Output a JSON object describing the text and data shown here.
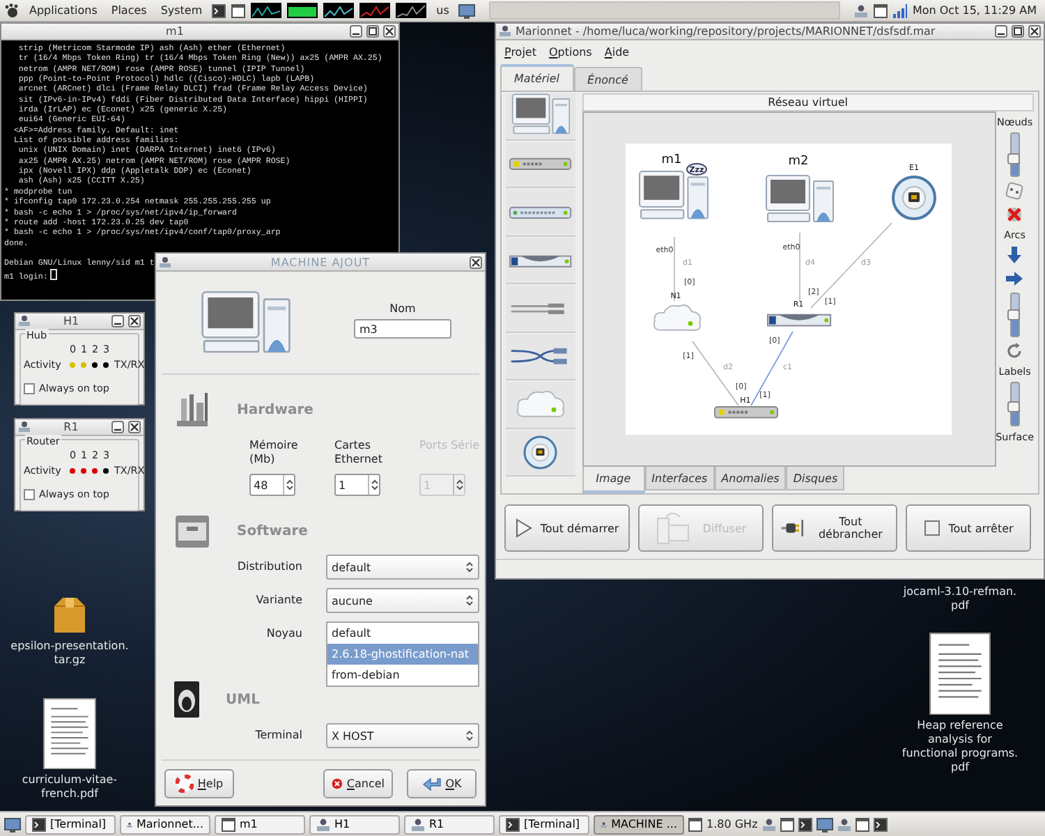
{
  "top_panel": {
    "menus": [
      "Applications",
      "Places",
      "System"
    ],
    "keyboard_layout": "us",
    "clock": "Mon Oct 15, 11:29 AM"
  },
  "terminal": {
    "title": "m1",
    "output": [
      "   strip (Metricom Starmode IP) ash (Ash) ether (Ethernet)",
      "   tr (16/4 Mbps Token Ring) tr (16/4 Mbps Token Ring (New)) ax25 (AMPR AX.25)",
      "   netrom (AMPR NET/ROM) rose (AMPR ROSE) tunnel (IPIP Tunnel)",
      "   ppp (Point-to-Point Protocol) hdlc ((Cisco)-HDLC) lapb (LAPB)",
      "   arcnet (ARCnet) dlci (Frame Relay DLCI) frad (Frame Relay Access Device)",
      "   sit (IPv6-in-IPv4) fddi (Fiber Distributed Data Interface) hippi (HIPPI)",
      "   irda (IrLAP) ec (Econet) x25 (generic X.25)",
      "   eui64 (Generic EUI-64)",
      "  <AF>=Address family. Default: inet",
      "  List of possible address families:",
      "   unix (UNIX Domain) inet (DARPA Internet) inet6 (IPv6)",
      "   ax25 (AMPR AX.25) netrom (AMPR NET/ROM) rose (AMPR ROSE)",
      "   ipx (Novell IPX) ddp (Appletalk DDP) ec (Econet)",
      "   ash (Ash) x25 (CCITT X.25)",
      "* modprobe tun",
      "* ifconfig tap0 172.23.0.254 netmask 255.255.255.255 up",
      "* bash -c echo 1 > /proc/sys/net/ipv4/ip_forward",
      "* route add -host 172.23.0.25 dev tap0",
      "* bash -c echo 1 > /proc/sys/net/ipv4/conf/tap0/proxy_arp",
      "done."
    ],
    "banner": "Debian GNU/Linux lenny/sid m1 t",
    "prompt": "m1 login:"
  },
  "monitors": [
    {
      "title": "H1",
      "group": "Hub",
      "ports": [
        "0",
        "1",
        "2",
        "3"
      ],
      "activity_label": "Activity",
      "traffic_label": "TX/RX",
      "leds": [
        {
          "color": "#d8c000"
        },
        {
          "color": "#d8c000"
        },
        {
          "color": "#000000"
        },
        {
          "color": "#000000"
        }
      ],
      "always_on_top": {
        "label": "Always on top",
        "checked": false
      }
    },
    {
      "title": "R1",
      "group": "Router",
      "ports": [
        "0",
        "1",
        "2",
        "3"
      ],
      "activity_label": "Activity",
      "traffic_label": "TX/RX",
      "leds": [
        {
          "color": "#e00000"
        },
        {
          "color": "#e00000"
        },
        {
          "color": "#e00000"
        },
        {
          "color": "#000000"
        }
      ],
      "always_on_top": {
        "label": "Always on top",
        "checked": false
      }
    }
  ],
  "dialog": {
    "title": "MACHINE AJOUT",
    "name_label": "Nom",
    "name_value": "m3",
    "hardware": {
      "heading": "Hardware",
      "fields": [
        {
          "label": "Mémoire (Mb)",
          "value": "48",
          "disabled": false
        },
        {
          "label": "Cartes Ethernet",
          "value": "1",
          "disabled": false
        },
        {
          "label": "Ports Série",
          "value": "1",
          "disabled": true
        }
      ]
    },
    "software": {
      "heading": "Software",
      "rows": [
        {
          "label": "Distribution",
          "kind": "combo",
          "value": "default"
        },
        {
          "label": "Variante",
          "kind": "combo",
          "value": "aucune"
        },
        {
          "label": "Noyau",
          "kind": "list",
          "options": [
            {
              "label": "default",
              "selected": false
            },
            {
              "label": "2.6.18-ghostification-nat",
              "selected": true
            },
            {
              "label": "from-debian",
              "selected": false
            }
          ]
        }
      ]
    },
    "uml": {
      "heading": "UML",
      "rows": [
        {
          "label": "Terminal",
          "kind": "combo",
          "value": "X HOST"
        }
      ]
    },
    "buttons": [
      {
        "label": "Help",
        "kind": "help"
      },
      {
        "label": "Cancel",
        "kind": "cancel"
      },
      {
        "label": "OK",
        "kind": "ok"
      }
    ]
  },
  "marionnet": {
    "title": "Marionnet - /home/luca/working/repository/projects/MARIONNET/dsfsdf.mar",
    "menus": [
      "Projet",
      "Options",
      "Aide"
    ],
    "tabs": [
      {
        "label": "Matériel",
        "selected": true
      },
      {
        "label": "Énoncé",
        "selected": false
      }
    ],
    "palette": [
      {
        "kind": "machine"
      },
      {
        "kind": "hub"
      },
      {
        "kind": "switch"
      },
      {
        "kind": "router"
      },
      {
        "kind": "cable"
      },
      {
        "kind": "crossover"
      },
      {
        "kind": "cloud"
      },
      {
        "kind": "socket"
      }
    ],
    "canvas_title": "Réseau virtuel",
    "diagram": {
      "nodes": [
        {
          "label": "m1",
          "kind": "machine",
          "sleep_badge": "Zzz"
        },
        {
          "label": "m2",
          "kind": "machine"
        },
        {
          "label": "E1",
          "kind": "socket"
        },
        {
          "label": "N1",
          "kind": "cloud"
        },
        {
          "label": "R1",
          "kind": "router"
        },
        {
          "label": "H1",
          "kind": "hub"
        }
      ],
      "links": [
        {
          "label": "d1",
          "kind": "straight",
          "end_a": "eth0",
          "end_b": "[0]"
        },
        {
          "label": "d4",
          "kind": "straight",
          "end_a": "eth0",
          "end_b": "[2]"
        },
        {
          "label": "d3",
          "kind": "straight",
          "end_b": "[1]"
        },
        {
          "label": "d2",
          "kind": "straight",
          "end_a": "[1]",
          "end_b": "[0]"
        },
        {
          "label": "c1",
          "kind": "crossover",
          "end_a": "[1]",
          "end_b": "[0]"
        }
      ]
    },
    "controls": [
      {
        "kind": "label",
        "text": "Nœuds"
      },
      {
        "kind": "slider",
        "level": 0.4
      },
      {
        "kind": "dice"
      },
      {
        "kind": "delete"
      },
      {
        "kind": "label",
        "text": "Arcs"
      },
      {
        "kind": "arrow-down"
      },
      {
        "kind": "arrow-right"
      },
      {
        "kind": "slider",
        "level": 0.5
      },
      {
        "kind": "rotate"
      },
      {
        "kind": "label",
        "text": "Labels"
      },
      {
        "kind": "slider",
        "level": 0.45
      },
      {
        "kind": "label",
        "text": "Surface"
      }
    ],
    "view_tabs": [
      {
        "label": "Image",
        "selected": true
      },
      {
        "label": "Interfaces",
        "selected": false
      },
      {
        "label": "Anomalies",
        "selected": false
      },
      {
        "label": "Disques",
        "selected": false
      }
    ],
    "actions": [
      {
        "label": "Tout démarrer",
        "kind": "play",
        "disabled": false
      },
      {
        "label": "Diffuser",
        "kind": "broadcast",
        "disabled": true
      },
      {
        "label": "Tout débrancher",
        "kind": "unplug",
        "disabled": false
      },
      {
        "label": "Tout arrêter",
        "kind": "stop",
        "disabled": false
      }
    ]
  },
  "desktop_icons": [
    {
      "lines": [
        "epsilon-presentation.",
        "tar.gz"
      ],
      "kind": "archive"
    },
    {
      "lines": [
        "curriculum-vitae-",
        "french.pdf"
      ],
      "kind": "document"
    },
    {
      "lines": [
        "jocaml-3.10-refman.",
        "pdf"
      ],
      "kind": "hidden"
    },
    {
      "lines": [
        "Heap reference",
        "analysis for",
        "functional programs.",
        "pdf"
      ],
      "kind": "document"
    }
  ],
  "taskbar": {
    "tasks": [
      {
        "label": "[Terminal]",
        "kind": "terminal",
        "selected": false
      },
      {
        "label": "Marionnet...",
        "kind": "app",
        "selected": false
      },
      {
        "label": "m1",
        "kind": "window",
        "selected": false
      },
      {
        "label": "H1",
        "kind": "app",
        "selected": false
      },
      {
        "label": "R1",
        "kind": "app",
        "selected": false
      },
      {
        "label": "[Terminal]",
        "kind": "terminal",
        "selected": false
      },
      {
        "label": "MACHINE ...",
        "kind": "app",
        "selected": true
      }
    ],
    "cpu_freq": "1.80 GHz"
  }
}
